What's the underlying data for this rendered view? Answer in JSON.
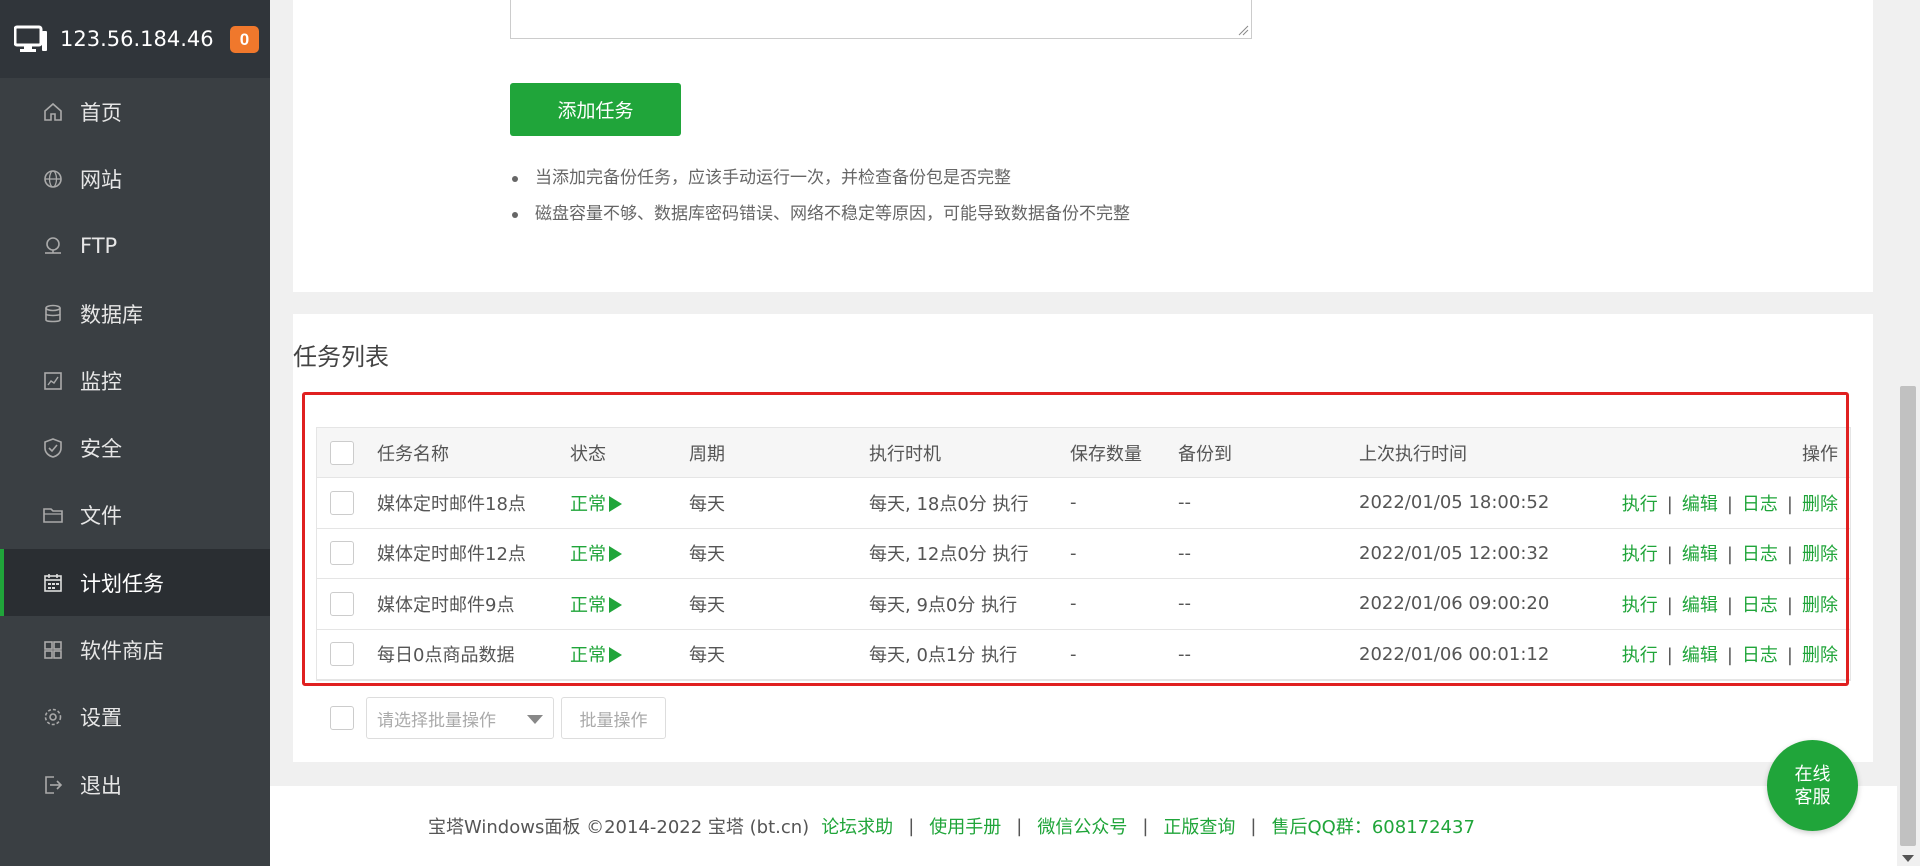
{
  "server": {
    "ip": "123.56.184.46",
    "badge": "0"
  },
  "nav": [
    {
      "label": "首页",
      "icon": "home-icon"
    },
    {
      "label": "网站",
      "icon": "globe-icon"
    },
    {
      "label": "FTP",
      "icon": "ftp-icon"
    },
    {
      "label": "数据库",
      "icon": "database-icon"
    },
    {
      "label": "监控",
      "icon": "monitor-chart-icon"
    },
    {
      "label": "安全",
      "icon": "shield-icon"
    },
    {
      "label": "文件",
      "icon": "folder-icon"
    },
    {
      "label": "计划任务",
      "icon": "calendar-icon",
      "active": true
    },
    {
      "label": "软件商店",
      "icon": "grid-icon"
    },
    {
      "label": "设置",
      "icon": "gear-icon"
    },
    {
      "label": "退出",
      "icon": "logout-icon"
    }
  ],
  "form": {
    "add_button": "添加任务",
    "tips": [
      "当添加完备份任务，应该手动运行一次，并检查备份包是否完整",
      "磁盘容量不够、数据库密码错误、网络不稳定等原因，可能导致数据备份不完整"
    ]
  },
  "task_list": {
    "title": "任务列表",
    "columns": {
      "name": "任务名称",
      "status": "状态",
      "cycle": "周期",
      "exec_time": "执行时机",
      "keep_count": "保存数量",
      "backup_to": "备份到",
      "last_run": "上次执行时间",
      "ops": "操作"
    },
    "rows": [
      {
        "name": "媒体定时邮件18点",
        "status": "正常",
        "cycle": "每天",
        "exec_time": "每天, 18点0分 执行",
        "keep_count": "-",
        "backup_to": "--",
        "last_run": "2022/01/05 18:00:52"
      },
      {
        "name": "媒体定时邮件12点",
        "status": "正常",
        "cycle": "每天",
        "exec_time": "每天, 12点0分 执行",
        "keep_count": "-",
        "backup_to": "--",
        "last_run": "2022/01/05 12:00:32"
      },
      {
        "name": "媒体定时邮件9点",
        "status": "正常",
        "cycle": "每天",
        "exec_time": "每天, 9点0分 执行",
        "keep_count": "-",
        "backup_to": "--",
        "last_run": "2022/01/06 09:00:20"
      },
      {
        "name": "每日0点商品数据",
        "status": "正常",
        "cycle": "每天",
        "exec_time": "每天, 0点1分 执行",
        "keep_count": "-",
        "backup_to": "--",
        "last_run": "2022/01/06 00:01:12"
      }
    ],
    "ops": {
      "run": "执行",
      "edit": "编辑",
      "log": "日志",
      "delete": "删除",
      "sep": "|"
    },
    "batch_placeholder": "请选择批量操作",
    "batch_button": "批量操作"
  },
  "footer": {
    "copyright": "宝塔Windows面板 ©2014-2022 宝塔 (bt.cn)",
    "links": [
      "论坛求助",
      "使用手册",
      "微信公众号",
      "正版查询",
      "售后QQ群：608172437"
    ],
    "sep": "|"
  },
  "chat": {
    "line1": "在线",
    "line2": "客服"
  },
  "colors": {
    "accent": "#20a53a",
    "sidebar": "#3a3f43",
    "badge": "#f0782c",
    "highlight": "#e02020"
  }
}
